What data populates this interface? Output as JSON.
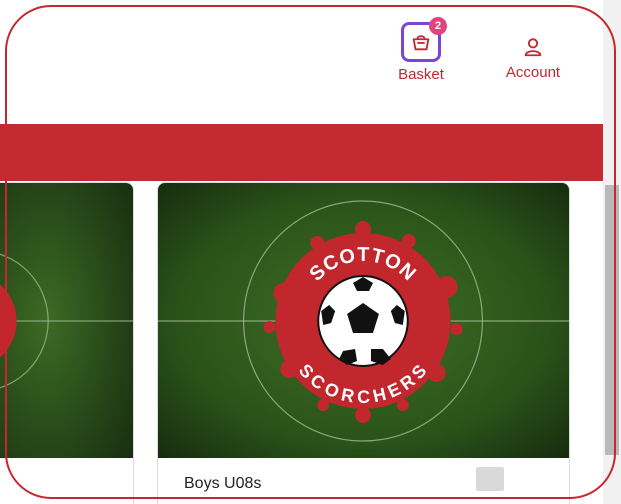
{
  "header": {
    "basket": {
      "label": "Basket",
      "count": "2",
      "icon": "basket-icon"
    },
    "account": {
      "label": "Account",
      "icon": "user-icon"
    }
  },
  "colors": {
    "brand_red": "#c42a32",
    "focus_purple": "#7b46d6",
    "badge_pink": "#e4437d"
  },
  "cards": [
    {
      "image": "scotton-scorchers-crest",
      "title": ""
    },
    {
      "image": "scotton-scorchers-crest",
      "logo_top_text": "SCOTTON",
      "logo_bottom_text": "SCORCHERS",
      "title": "Boys U08s"
    }
  ]
}
